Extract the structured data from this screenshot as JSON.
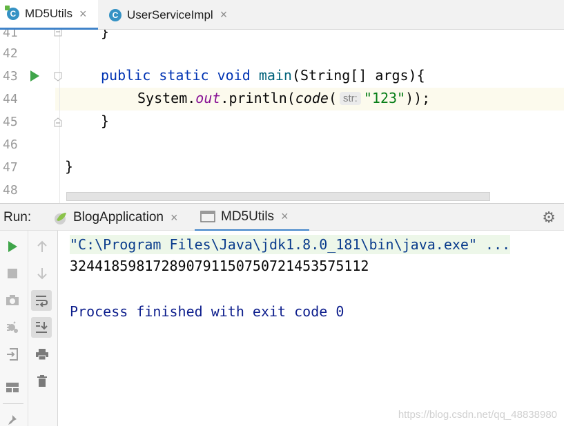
{
  "editor_tabs": [
    {
      "label": "MD5Utils",
      "close": "×"
    },
    {
      "label": "UserServiceImpl",
      "close": "×"
    }
  ],
  "editor": {
    "line_numbers": [
      "41",
      "42",
      "43",
      "44",
      "45",
      "46",
      "47",
      "48"
    ],
    "line43": {
      "kw1": "public",
      "kw2": "static",
      "kw3": "void",
      "fn": "main",
      "rest": "(String[] args){"
    },
    "line44": {
      "obj": "System.",
      "field": "out",
      "call": ".println(",
      "method": "code",
      "open": "(",
      "hint": "str:",
      "string": "\"123\"",
      "close": "));"
    },
    "line45": "}",
    "line47": "}",
    "line41": "}"
  },
  "run_panel": {
    "label": "Run:",
    "tabs": [
      {
        "label": "BlogApplication",
        "close": "×"
      },
      {
        "label": "MD5Utils",
        "close": "×"
      }
    ]
  },
  "console": {
    "command": "\"C:\\Program Files\\Java\\jdk1.8.0_181\\bin\\java.exe\" ...",
    "output": "324418598172890791150750721453575112",
    "exit_message": "Process finished with exit code 0"
  },
  "watermark": "https://blog.csdn.net/qq_48838980",
  "icons": [
    "run-icon",
    "stop-icon",
    "camera-icon",
    "settings-bug-icon",
    "exit-icon",
    "layout-icon",
    "pin-icon",
    "arrow-up-icon",
    "arrow-down-icon",
    "soft-wrap-icon",
    "scroll-to-end-icon",
    "print-icon",
    "trash-icon",
    "gear-icon"
  ],
  "colors": {
    "accent": "#4083c9",
    "keyword": "#0033b3",
    "string": "#067d17",
    "run_green": "#3fa54a"
  }
}
